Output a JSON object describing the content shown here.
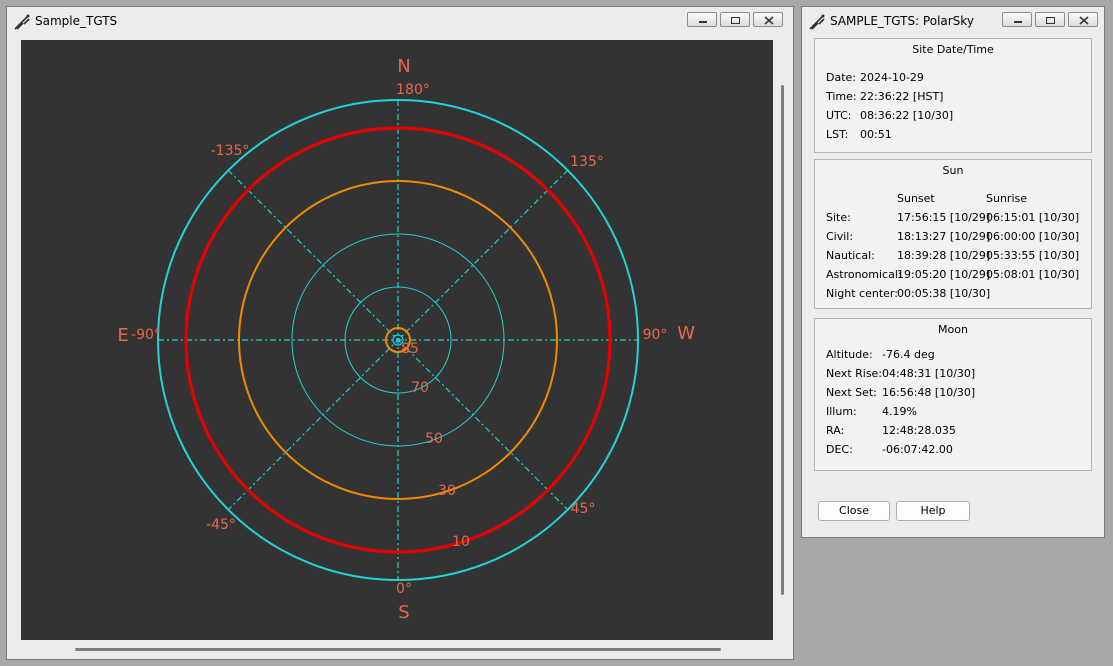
{
  "main_window": {
    "title": "Sample_TGTS"
  },
  "polar_plot": {
    "compass": {
      "north": "N",
      "south": "S",
      "east": "E",
      "west": "W"
    },
    "azimuth_labels": [
      "180°",
      "135°",
      "-135°",
      "90°",
      "-90°",
      "45°",
      "-45°",
      "0°"
    ],
    "altitude_labels": [
      "85",
      "70",
      "50",
      "30",
      "10"
    ],
    "colors": {
      "background": "#333333",
      "grid": "#22d3d8",
      "horizon": "#e60000",
      "twilight": "#f08c00",
      "label": "#e56a4a"
    }
  },
  "polarsky_window": {
    "title": "SAMPLE_TGTS: PolarSky",
    "site_datetime": {
      "heading": "Site Date/Time",
      "rows": [
        {
          "label": "Date:",
          "value": "2024-10-29"
        },
        {
          "label": "Time:",
          "value": "22:36:22 [HST]"
        },
        {
          "label": "UTC:",
          "value": "08:36:22 [10/30]"
        },
        {
          "label": "LST:",
          "value": "00:51"
        }
      ]
    },
    "sun": {
      "heading": "Sun",
      "col_sunset": "Sunset",
      "col_sunrise": "Sunrise",
      "rows": [
        {
          "label": "Site:",
          "sunset": "17:56:15 [10/29]",
          "sunrise": "06:15:01 [10/30]"
        },
        {
          "label": "Civil:",
          "sunset": "18:13:27 [10/29]",
          "sunrise": "06:00:00 [10/30]"
        },
        {
          "label": "Nautical:",
          "sunset": "18:39:28 [10/29]",
          "sunrise": "05:33:55 [10/30]"
        },
        {
          "label": "Astronomical:",
          "sunset": "19:05:20 [10/29]",
          "sunrise": "05:08:01 [10/30]"
        }
      ],
      "night_center": {
        "label": "Night center:",
        "value": "00:05:38 [10/30]"
      }
    },
    "moon": {
      "heading": "Moon",
      "rows": [
        {
          "label": "Altitude:",
          "value": "-76.4 deg"
        },
        {
          "label": "Next Rise:",
          "value": "04:48:31 [10/30]"
        },
        {
          "label": "Next Set:",
          "value": "16:56:48 [10/30]"
        },
        {
          "label": "Illum:",
          "value": "4.19%"
        },
        {
          "label": "RA:",
          "value": "12:48:28.035"
        },
        {
          "label": "DEC:",
          "value": "-06:07:42.00"
        }
      ]
    },
    "buttons": {
      "close": "Close",
      "help": "Help"
    }
  }
}
